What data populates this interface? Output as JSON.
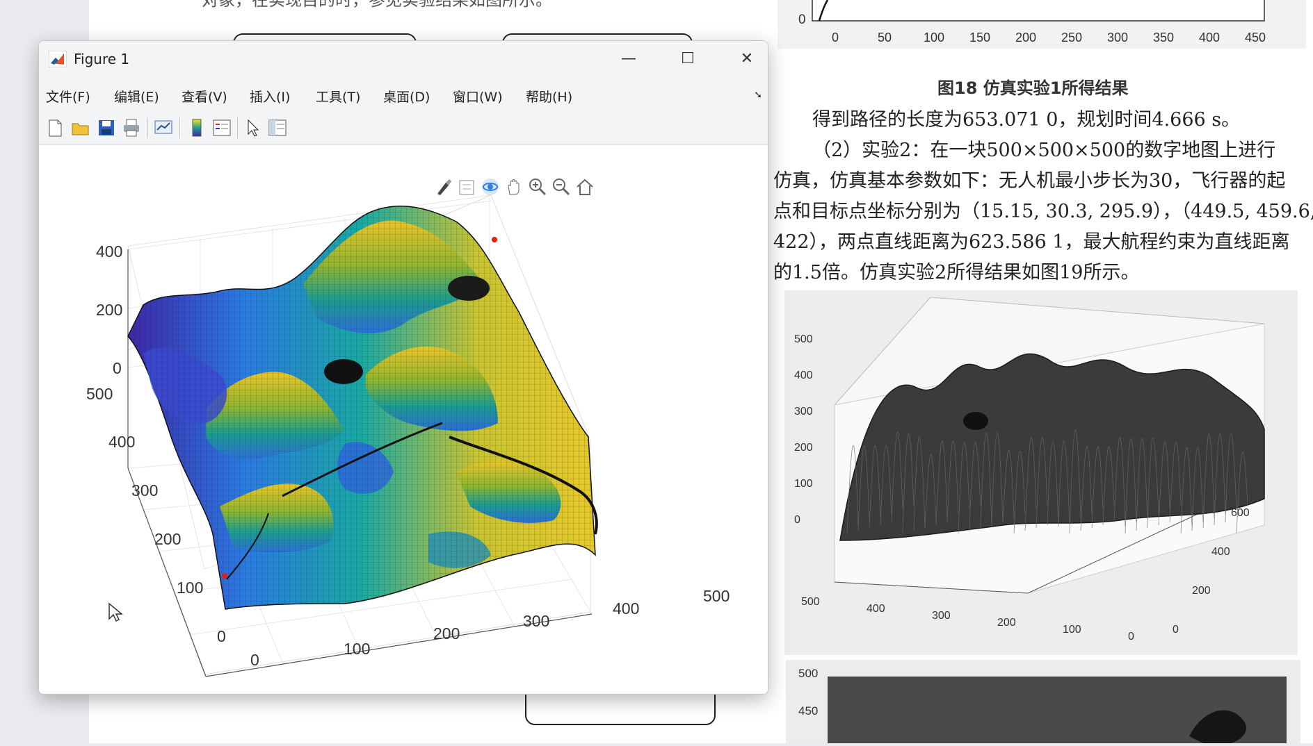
{
  "document": {
    "top_partial_line": "对象，在实现目的时，参见实验结果如图所示。",
    "top_axis_ticks_x": [
      "0",
      "50",
      "100",
      "150",
      "200",
      "250",
      "300",
      "350",
      "400",
      "450"
    ],
    "top_axis_tick_y": "0",
    "figure18_caption": "图18  仿真实验1所得结果",
    "paragraph": [
      "得到路径的长度为653.071 0，规划时间4.666 s。",
      "（2）实验2：在一块500×500×500的数字地图上进行",
      "仿真，仿真基本参数如下：无人机最小步长为30，飞行器的起",
      "点和目标点坐标分别为（15.15, 30.3, 295.9），（449.5, 459.6,",
      "422），两点直线距离为623.586 1，最大航程约束为直线距离",
      "的1.5倍。仿真实验2所得结果如图19所示。"
    ],
    "gray_plot": {
      "z_ticks": [
        "500",
        "400",
        "300",
        "200",
        "100",
        "0"
      ],
      "x_ticks": [
        "500",
        "400",
        "300",
        "200",
        "100",
        "0"
      ],
      "y_ticks": [
        "0",
        "200",
        "400",
        "600"
      ]
    },
    "gray_plot2_ticks": [
      "500",
      "450"
    ]
  },
  "figure_window": {
    "title": "Figure 1",
    "controls": {
      "minimize": "—",
      "maximize": "☐",
      "close": "✕"
    },
    "menus": [
      "文件(F)",
      "编辑(E)",
      "查看(V)",
      "插入(I)",
      "工具(T)",
      "桌面(D)",
      "窗口(W)",
      "帮助(H)"
    ],
    "toolbar_icons": [
      "new-file-icon",
      "open-folder-icon",
      "save-icon",
      "print-icon",
      "link-plot-icon",
      "insert-colorbar-icon",
      "insert-legend-icon",
      "edit-plot-icon",
      "property-inspector-icon"
    ],
    "axes_toolbar_icons": [
      "brush-icon",
      "datatip-icon",
      "rotate-3d-icon",
      "pan-icon",
      "zoom-in-icon",
      "zoom-out-icon",
      "restore-view-icon"
    ],
    "plot": {
      "z_ticks": [
        "400",
        "200",
        "0"
      ],
      "y_ticks": [
        "500",
        "400",
        "300",
        "200",
        "100",
        "0"
      ],
      "x_ticks": [
        "0",
        "100",
        "200",
        "300",
        "400",
        "500"
      ],
      "colormap": "parula",
      "colors": {
        "low": "#3e26a8",
        "mid": "#1fa08d",
        "high": "#e6c82a"
      }
    }
  }
}
